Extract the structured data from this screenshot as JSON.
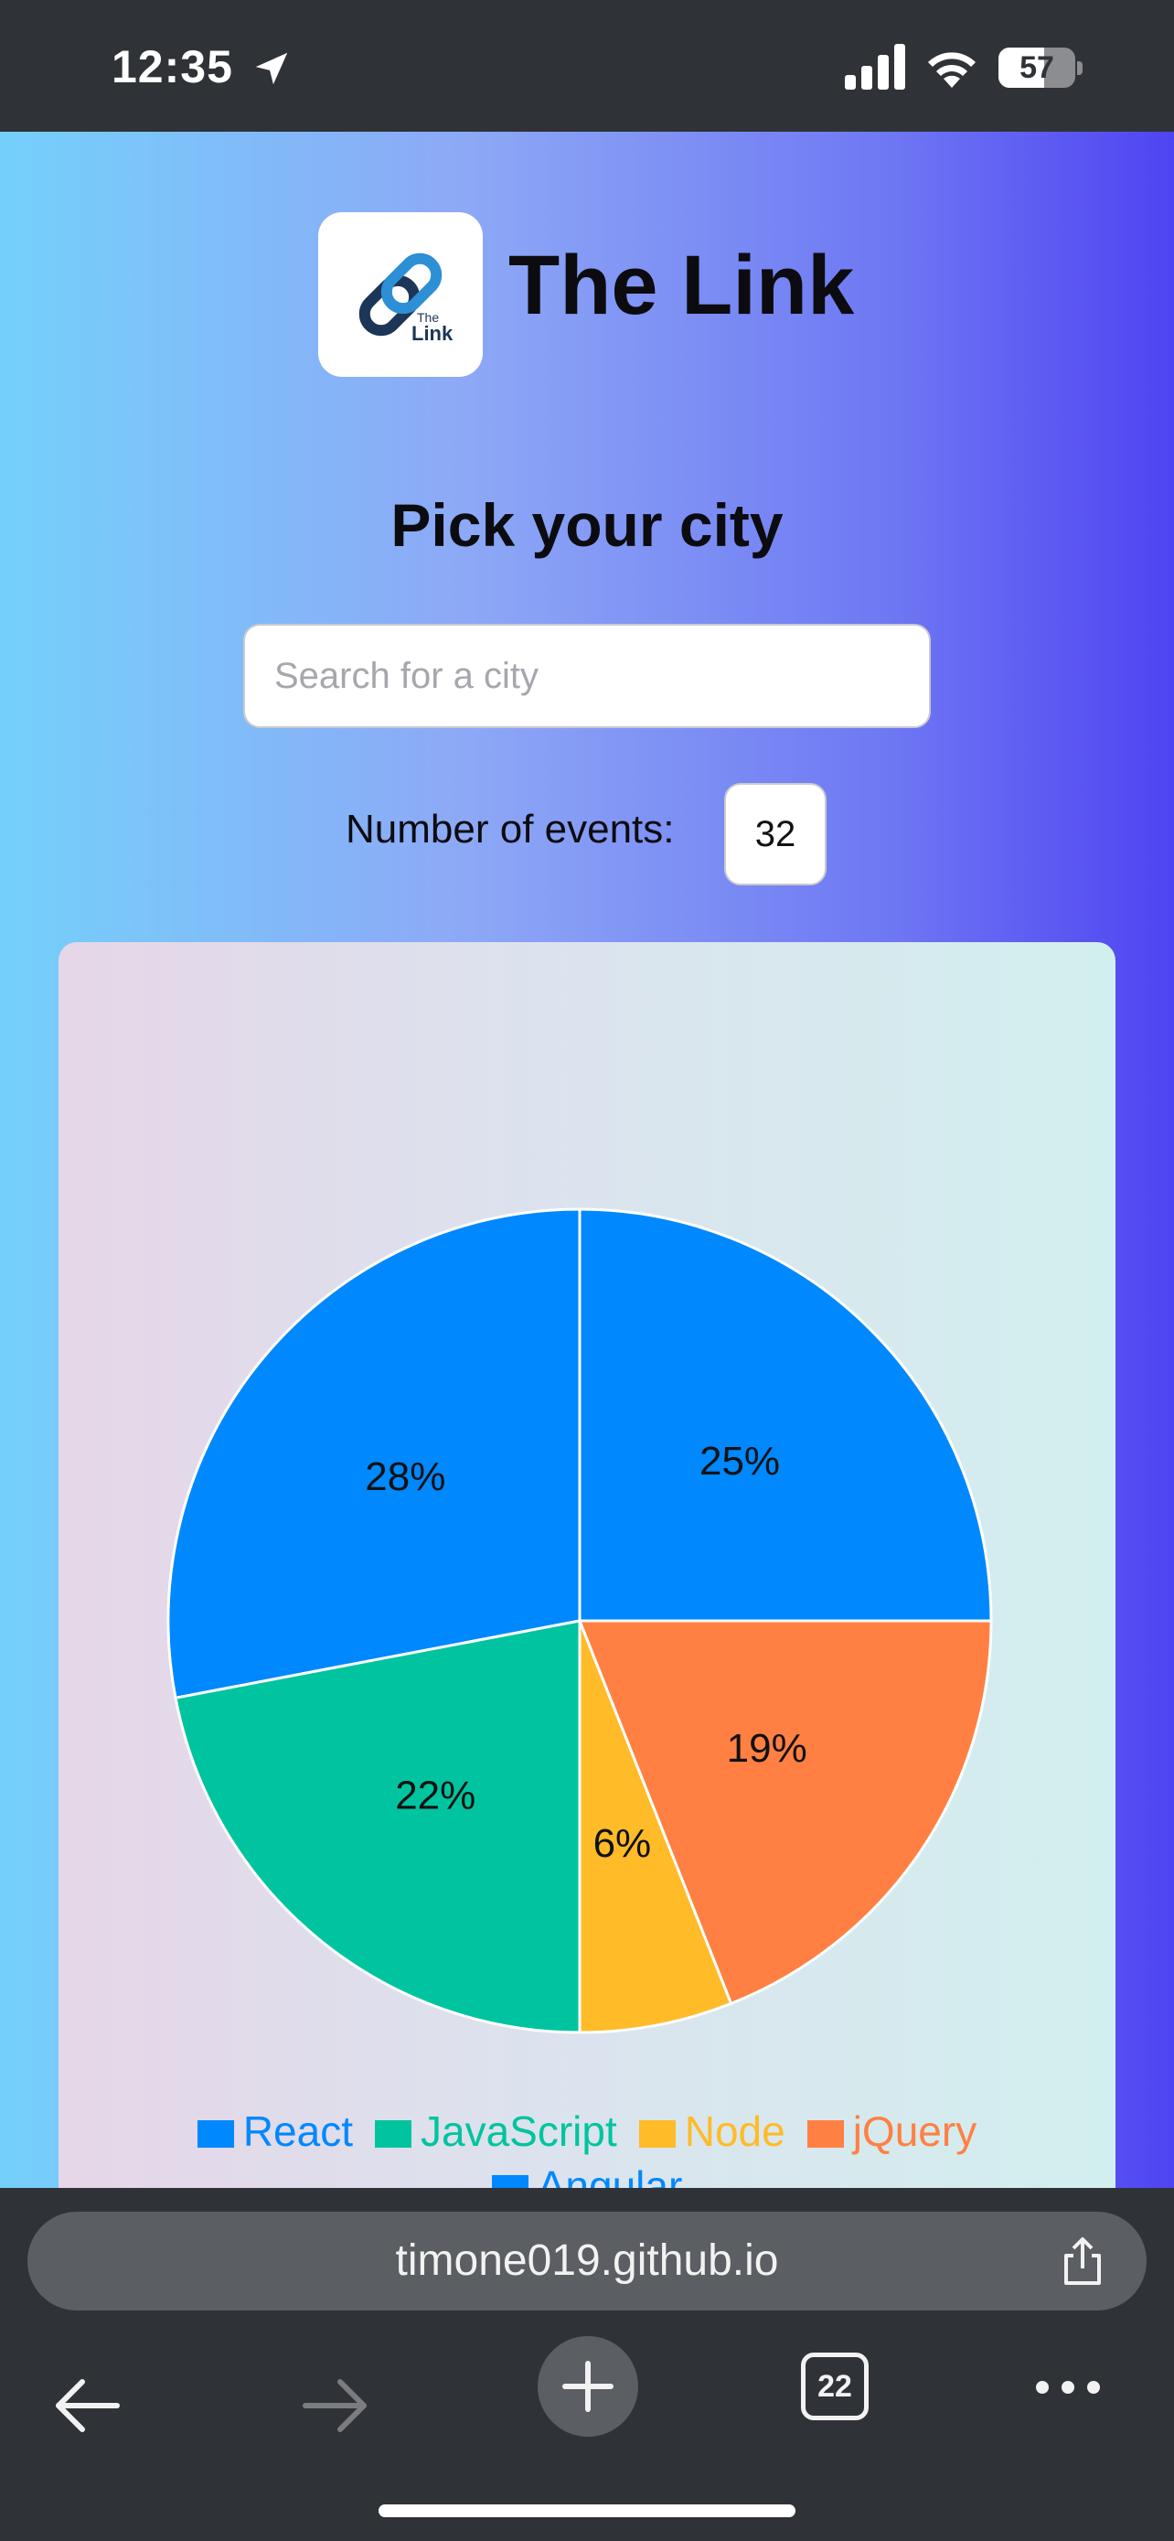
{
  "status_bar": {
    "time": "12:35",
    "battery": "57"
  },
  "app": {
    "title": "The Link",
    "logo_text_top": "The",
    "logo_text_bottom": "Link"
  },
  "heading": "Pick your city",
  "search": {
    "placeholder": "Search for a city",
    "value": ""
  },
  "events": {
    "label": "Number of events:",
    "value": "32"
  },
  "colors": {
    "react": "#0088fe",
    "javascript": "#00c49f",
    "node": "#ffbb28",
    "jquery": "#ff8042",
    "angular": "#0088fe"
  },
  "chart_data": {
    "type": "pie",
    "labels": [
      "React",
      "JavaScript",
      "Node",
      "jQuery",
      "Angular"
    ],
    "values": [
      28,
      22,
      6,
      19,
      25
    ],
    "value_labels": [
      "28%",
      "22%",
      "6%",
      "19%",
      "25%"
    ],
    "colors": [
      "#0088fe",
      "#00c49f",
      "#ffbb28",
      "#ff8042",
      "#0088fe"
    ],
    "start_angle_deg": 90,
    "legend_position": "bottom"
  },
  "second_chart": {
    "first_tick": "4"
  },
  "browser": {
    "url": "timone019.github.io",
    "tab_count": "22"
  }
}
